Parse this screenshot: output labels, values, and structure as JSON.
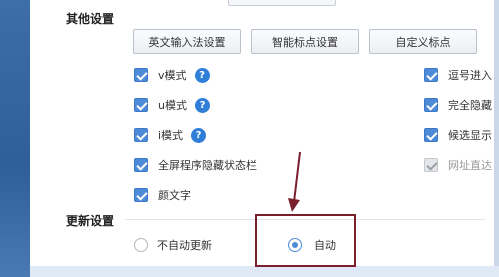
{
  "sections": {
    "other": {
      "title": "其他设置",
      "buttons": [
        "英文输入法设置",
        "智能标点设置",
        "自定义标点"
      ]
    },
    "update": {
      "title": "更新设置",
      "radio_options": [
        {
          "label": "不自动更新",
          "selected": false
        },
        {
          "label": "自动",
          "selected": true
        }
      ]
    }
  },
  "left_options": [
    {
      "label": "v模式",
      "checked": true,
      "help": true
    },
    {
      "label": "u模式",
      "checked": true,
      "help": true
    },
    {
      "label": "i模式",
      "checked": true,
      "help": true
    },
    {
      "label": "全屏程序隐藏状态栏",
      "checked": true,
      "help": false
    },
    {
      "label": "颜文字",
      "checked": true,
      "help": false
    }
  ],
  "right_options": [
    {
      "label": "逗号进入",
      "checked": true,
      "disabled": false
    },
    {
      "label": "完全隐藏",
      "checked": true,
      "disabled": false
    },
    {
      "label": "候选显示",
      "checked": true,
      "disabled": false
    },
    {
      "label": "网址直达",
      "checked": true,
      "disabled": true
    }
  ],
  "help_glyph": "?",
  "colors": {
    "accent": "#4d8ad8",
    "help_icon": "#2f7fd8",
    "annotation": "#7a1f2b",
    "sidebar": "#2f5f99"
  }
}
